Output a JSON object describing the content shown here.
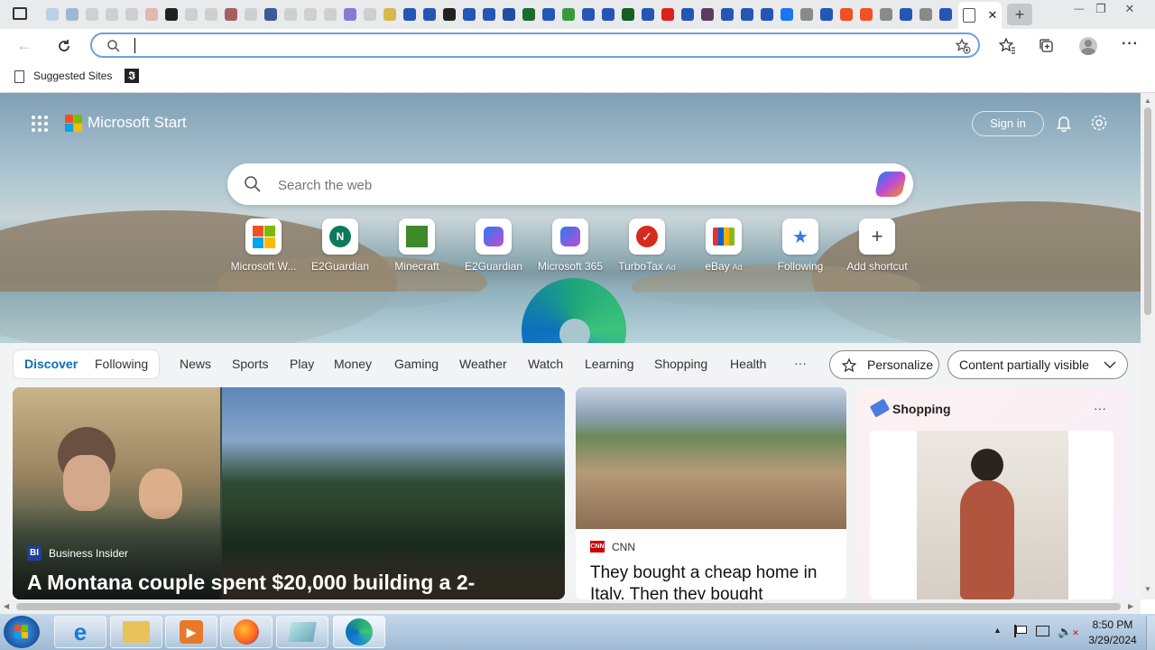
{
  "tabs": {
    "close_symbol": "✕",
    "new_tab_symbol": "+"
  },
  "window": {
    "minimize": "—",
    "restore": "❐",
    "close": "✕"
  },
  "address": {
    "value": "",
    "placeholder": ""
  },
  "favorites": {
    "item1": "Suggested Sites"
  },
  "header": {
    "brand": "Microsoft Start",
    "sign_in": "Sign in"
  },
  "search": {
    "placeholder": "Search the web"
  },
  "shortcuts": [
    {
      "label": "Microsoft W...",
      "ad": ""
    },
    {
      "label": "E2Guardian",
      "ad": ""
    },
    {
      "label": "Minecraft",
      "ad": ""
    },
    {
      "label": "E2Guardian",
      "ad": ""
    },
    {
      "label": "Microsoft 365",
      "ad": ""
    },
    {
      "label": "TurboTax",
      "ad": "Ad"
    },
    {
      "label": "eBay",
      "ad": "Ad"
    },
    {
      "label": "Following",
      "ad": ""
    },
    {
      "label": "Add shortcut",
      "ad": ""
    }
  ],
  "feednav": {
    "discover": "Discover",
    "following": "Following",
    "items": [
      "News",
      "Sports",
      "Play",
      "Money",
      "Gaming",
      "Weather",
      "Watch",
      "Learning",
      "Shopping",
      "Health"
    ],
    "more": "···",
    "personalize": "Personalize",
    "content_visibility": "Content partially visible"
  },
  "cards": {
    "main": {
      "source_badge": "BI",
      "source": "Business Insider",
      "headline": "A Montana couple spent $20,000 building a 2-"
    },
    "cnn": {
      "source_badge": "CNN",
      "source": "CNN",
      "headline": "They bought a cheap home in Italy. Then they bought"
    },
    "shopping": {
      "title": "Shopping",
      "more": "···"
    }
  },
  "clock": {
    "time": "8:50 PM",
    "date": "3/29/2024"
  },
  "colors": {
    "accent": "#0f6cbd",
    "taskbar": "#b3c9df"
  }
}
